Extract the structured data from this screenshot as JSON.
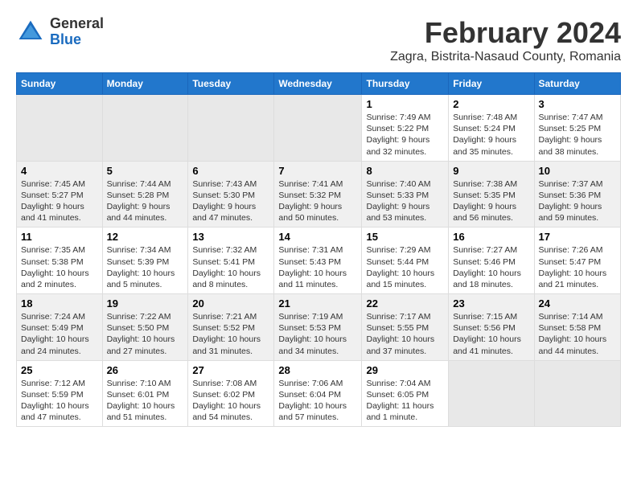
{
  "header": {
    "logo_general": "General",
    "logo_blue": "Blue",
    "main_title": "February 2024",
    "sub_title": "Zagra, Bistrita-Nasaud County, Romania"
  },
  "calendar": {
    "days_of_week": [
      "Sunday",
      "Monday",
      "Tuesday",
      "Wednesday",
      "Thursday",
      "Friday",
      "Saturday"
    ],
    "weeks": [
      {
        "id": "week1",
        "days": [
          {
            "num": "",
            "info": "",
            "empty": true
          },
          {
            "num": "",
            "info": "",
            "empty": true
          },
          {
            "num": "",
            "info": "",
            "empty": true
          },
          {
            "num": "",
            "info": "",
            "empty": true
          },
          {
            "num": "1",
            "info": "Sunrise: 7:49 AM\nSunset: 5:22 PM\nDaylight: 9 hours and 32 minutes.",
            "empty": false
          },
          {
            "num": "2",
            "info": "Sunrise: 7:48 AM\nSunset: 5:24 PM\nDaylight: 9 hours and 35 minutes.",
            "empty": false
          },
          {
            "num": "3",
            "info": "Sunrise: 7:47 AM\nSunset: 5:25 PM\nDaylight: 9 hours and 38 minutes.",
            "empty": false
          }
        ]
      },
      {
        "id": "week2",
        "days": [
          {
            "num": "4",
            "info": "Sunrise: 7:45 AM\nSunset: 5:27 PM\nDaylight: 9 hours and 41 minutes.",
            "empty": false
          },
          {
            "num": "5",
            "info": "Sunrise: 7:44 AM\nSunset: 5:28 PM\nDaylight: 9 hours and 44 minutes.",
            "empty": false
          },
          {
            "num": "6",
            "info": "Sunrise: 7:43 AM\nSunset: 5:30 PM\nDaylight: 9 hours and 47 minutes.",
            "empty": false
          },
          {
            "num": "7",
            "info": "Sunrise: 7:41 AM\nSunset: 5:32 PM\nDaylight: 9 hours and 50 minutes.",
            "empty": false
          },
          {
            "num": "8",
            "info": "Sunrise: 7:40 AM\nSunset: 5:33 PM\nDaylight: 9 hours and 53 minutes.",
            "empty": false
          },
          {
            "num": "9",
            "info": "Sunrise: 7:38 AM\nSunset: 5:35 PM\nDaylight: 9 hours and 56 minutes.",
            "empty": false
          },
          {
            "num": "10",
            "info": "Sunrise: 7:37 AM\nSunset: 5:36 PM\nDaylight: 9 hours and 59 minutes.",
            "empty": false
          }
        ]
      },
      {
        "id": "week3",
        "days": [
          {
            "num": "11",
            "info": "Sunrise: 7:35 AM\nSunset: 5:38 PM\nDaylight: 10 hours and 2 minutes.",
            "empty": false
          },
          {
            "num": "12",
            "info": "Sunrise: 7:34 AM\nSunset: 5:39 PM\nDaylight: 10 hours and 5 minutes.",
            "empty": false
          },
          {
            "num": "13",
            "info": "Sunrise: 7:32 AM\nSunset: 5:41 PM\nDaylight: 10 hours and 8 minutes.",
            "empty": false
          },
          {
            "num": "14",
            "info": "Sunrise: 7:31 AM\nSunset: 5:43 PM\nDaylight: 10 hours and 11 minutes.",
            "empty": false
          },
          {
            "num": "15",
            "info": "Sunrise: 7:29 AM\nSunset: 5:44 PM\nDaylight: 10 hours and 15 minutes.",
            "empty": false
          },
          {
            "num": "16",
            "info": "Sunrise: 7:27 AM\nSunset: 5:46 PM\nDaylight: 10 hours and 18 minutes.",
            "empty": false
          },
          {
            "num": "17",
            "info": "Sunrise: 7:26 AM\nSunset: 5:47 PM\nDaylight: 10 hours and 21 minutes.",
            "empty": false
          }
        ]
      },
      {
        "id": "week4",
        "days": [
          {
            "num": "18",
            "info": "Sunrise: 7:24 AM\nSunset: 5:49 PM\nDaylight: 10 hours and 24 minutes.",
            "empty": false
          },
          {
            "num": "19",
            "info": "Sunrise: 7:22 AM\nSunset: 5:50 PM\nDaylight: 10 hours and 27 minutes.",
            "empty": false
          },
          {
            "num": "20",
            "info": "Sunrise: 7:21 AM\nSunset: 5:52 PM\nDaylight: 10 hours and 31 minutes.",
            "empty": false
          },
          {
            "num": "21",
            "info": "Sunrise: 7:19 AM\nSunset: 5:53 PM\nDaylight: 10 hours and 34 minutes.",
            "empty": false
          },
          {
            "num": "22",
            "info": "Sunrise: 7:17 AM\nSunset: 5:55 PM\nDaylight: 10 hours and 37 minutes.",
            "empty": false
          },
          {
            "num": "23",
            "info": "Sunrise: 7:15 AM\nSunset: 5:56 PM\nDaylight: 10 hours and 41 minutes.",
            "empty": false
          },
          {
            "num": "24",
            "info": "Sunrise: 7:14 AM\nSunset: 5:58 PM\nDaylight: 10 hours and 44 minutes.",
            "empty": false
          }
        ]
      },
      {
        "id": "week5",
        "days": [
          {
            "num": "25",
            "info": "Sunrise: 7:12 AM\nSunset: 5:59 PM\nDaylight: 10 hours and 47 minutes.",
            "empty": false
          },
          {
            "num": "26",
            "info": "Sunrise: 7:10 AM\nSunset: 6:01 PM\nDaylight: 10 hours and 51 minutes.",
            "empty": false
          },
          {
            "num": "27",
            "info": "Sunrise: 7:08 AM\nSunset: 6:02 PM\nDaylight: 10 hours and 54 minutes.",
            "empty": false
          },
          {
            "num": "28",
            "info": "Sunrise: 7:06 AM\nSunset: 6:04 PM\nDaylight: 10 hours and 57 minutes.",
            "empty": false
          },
          {
            "num": "29",
            "info": "Sunrise: 7:04 AM\nSunset: 6:05 PM\nDaylight: 11 hours and 1 minute.",
            "empty": false
          },
          {
            "num": "",
            "info": "",
            "empty": true
          },
          {
            "num": "",
            "info": "",
            "empty": true
          }
        ]
      }
    ]
  }
}
